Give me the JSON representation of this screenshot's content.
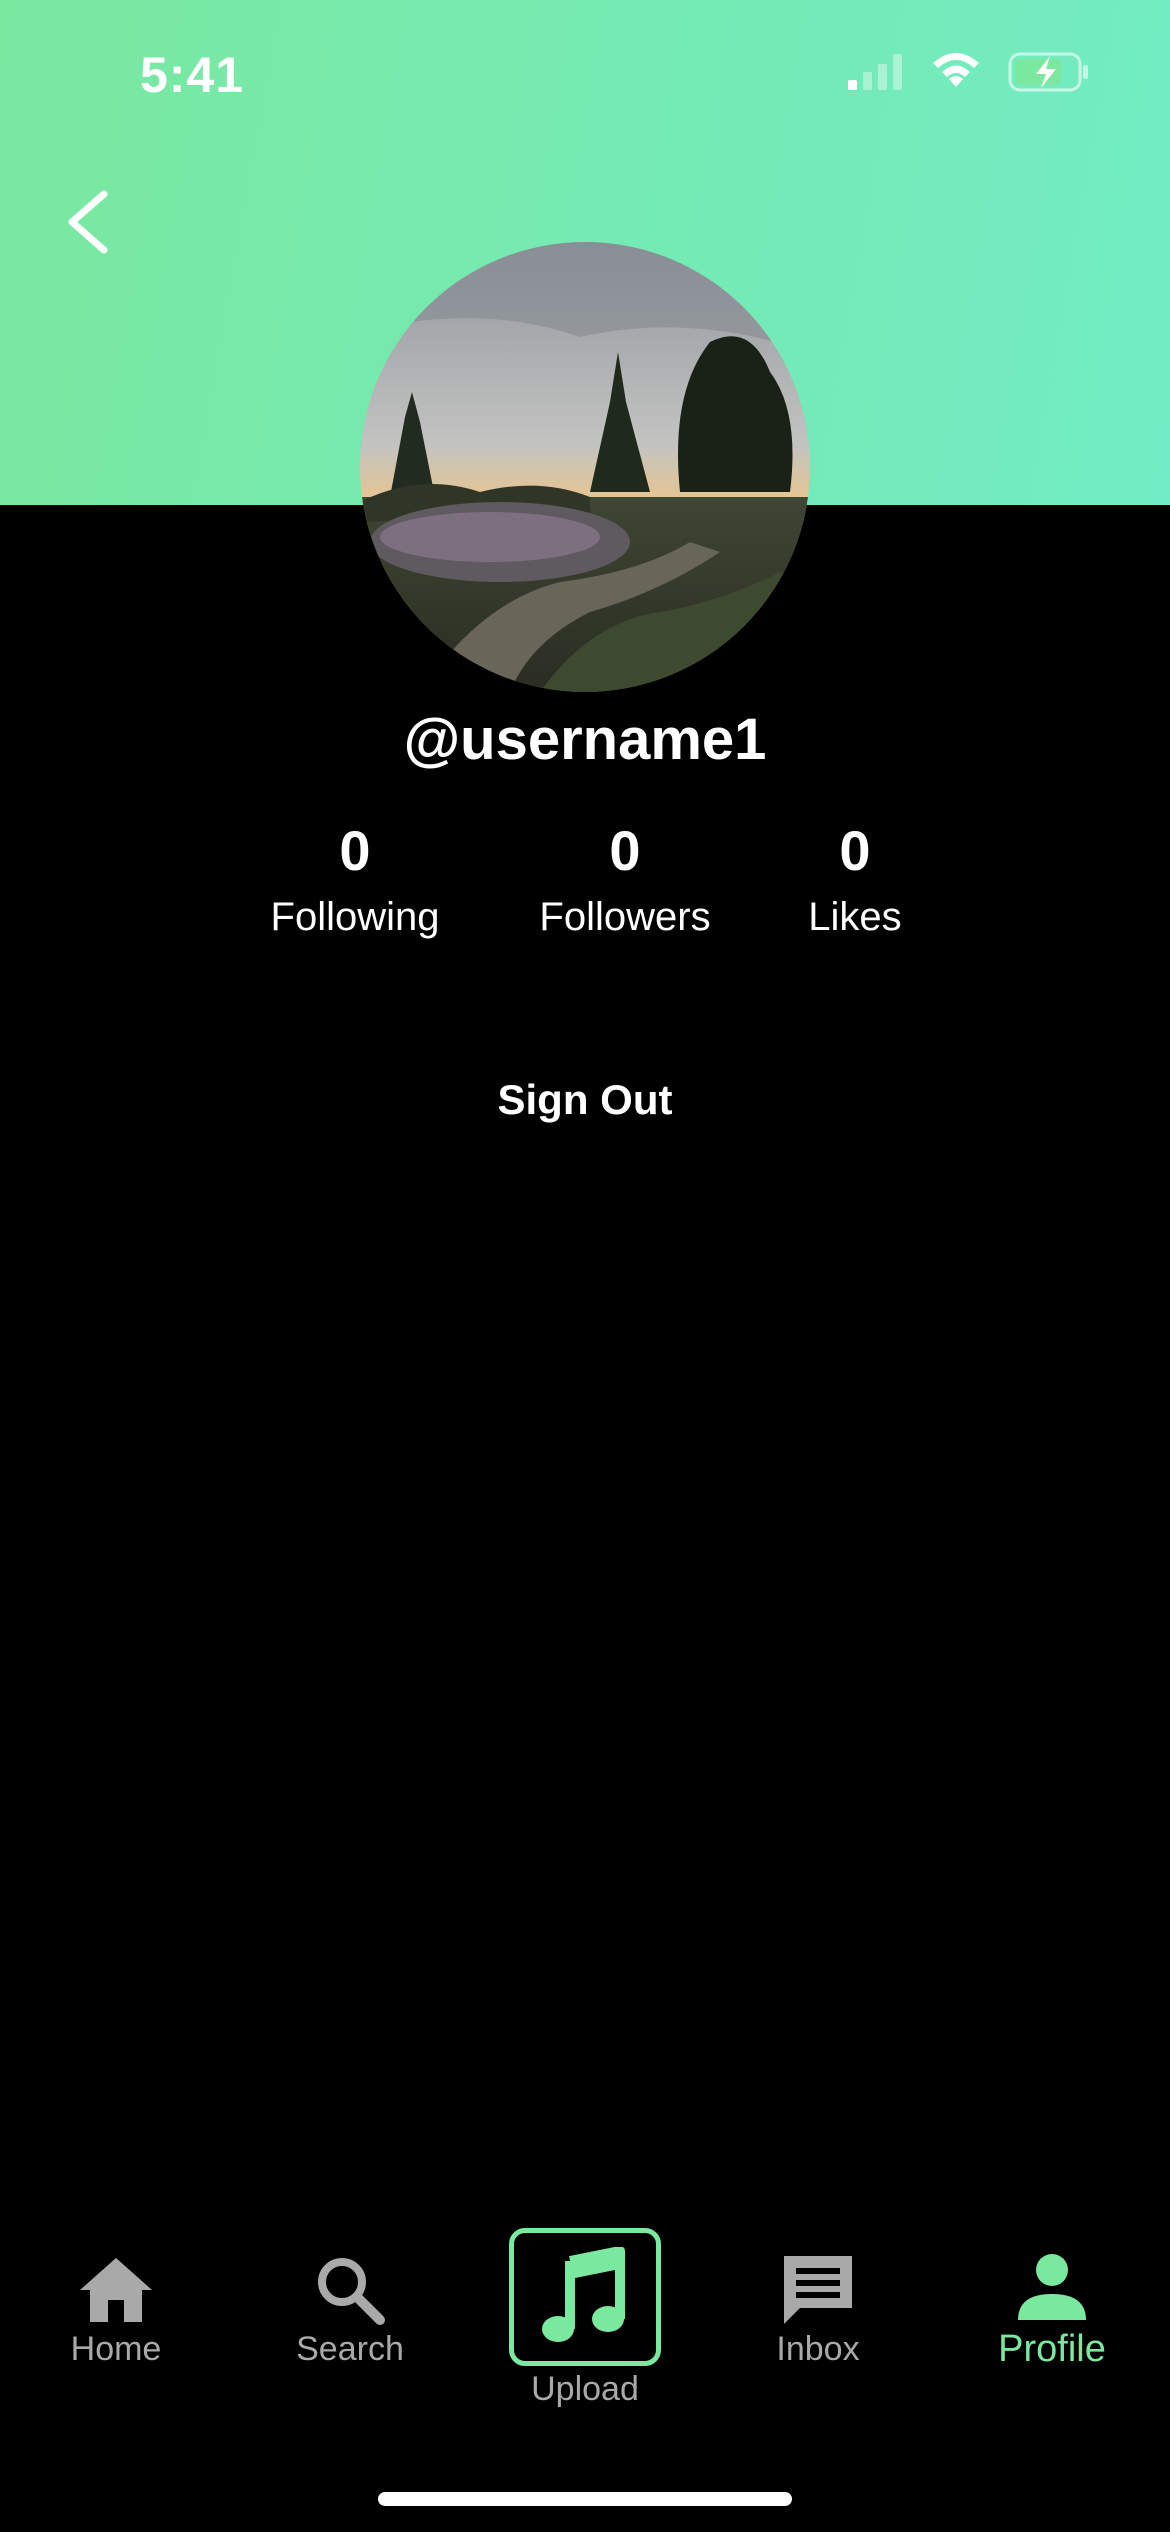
{
  "status_bar": {
    "time": "5:41"
  },
  "profile": {
    "username": "@username1",
    "stats": [
      {
        "value": "0",
        "label": "Following"
      },
      {
        "value": "0",
        "label": "Followers"
      },
      {
        "value": "0",
        "label": "Likes"
      }
    ],
    "sign_out_label": "Sign Out"
  },
  "tabbar": {
    "items": [
      {
        "label": "Home",
        "icon": "home-icon"
      },
      {
        "label": "Search",
        "icon": "search-icon"
      },
      {
        "label": "Upload",
        "icon": "music-note-icon"
      },
      {
        "label": "Inbox",
        "icon": "inbox-icon"
      },
      {
        "label": "Profile",
        "icon": "person-icon"
      }
    ],
    "active_index": 4
  },
  "colors": {
    "accent": "#7ae89f",
    "header_gradient_end": "#72ecc4",
    "inactive_tab": "#a9a9a9",
    "background": "#000000"
  }
}
